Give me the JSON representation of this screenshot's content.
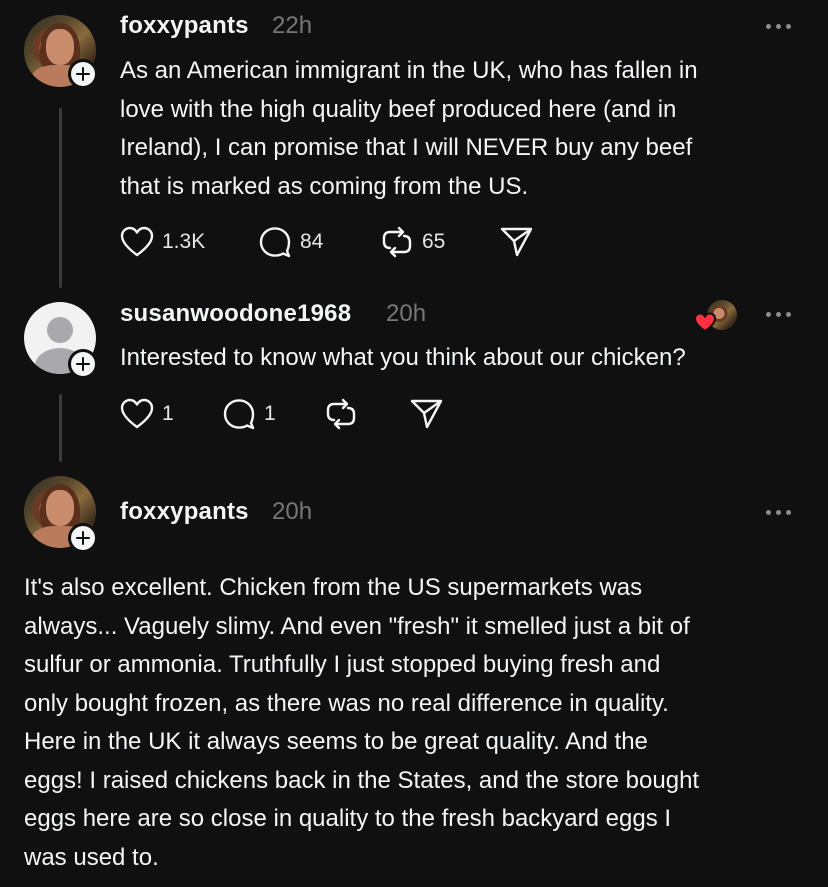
{
  "posts": [
    {
      "username": "foxxypants",
      "time": "22h",
      "text": "As an American immigrant in the UK, who has fallen in love with the high quality beef produced here (and in Ireland), I can promise that I will NEVER buy any beef that is marked as coming from the US.",
      "lines": [
        "As an American immigrant in the UK, who has fallen in",
        "love with the high quality beef produced here (and in",
        "Ireland), I can promise that I will NEVER buy any beef",
        "that is marked as coming from the US."
      ],
      "likes": "1.3K",
      "replies": "84",
      "reposts": "65"
    },
    {
      "username": "susanwoodone1968",
      "time": "20h",
      "text": "Interested to know what you think about our chicken?",
      "likes": "1",
      "replies": "1",
      "reposts": ""
    },
    {
      "username": "foxxypants",
      "time": "20h",
      "lines": [
        "It's also excellent. Chicken from the US supermarkets was",
        "always... Vaguely slimy. And even \"fresh\" it smelled just a bit of",
        "sulfur or ammonia. Truthfully I just stopped buying fresh and",
        "only bought frozen, as there was no real difference in quality.",
        "Here in the UK it always seems to be great quality. And the",
        "eggs! I raised chickens back in the States, and the store bought",
        "eggs here are so close in quality to the fresh backyard eggs I",
        "was used to."
      ]
    }
  ],
  "colors": {
    "background": "#101010",
    "text": "#f3f5f7",
    "muted": "#777777",
    "like_heart": "#ff3040"
  },
  "icons": {
    "like": "heart-icon",
    "reply": "comment-icon",
    "repost": "repost-icon",
    "share": "send-icon",
    "more": "more-icon",
    "follow": "plus-icon"
  }
}
